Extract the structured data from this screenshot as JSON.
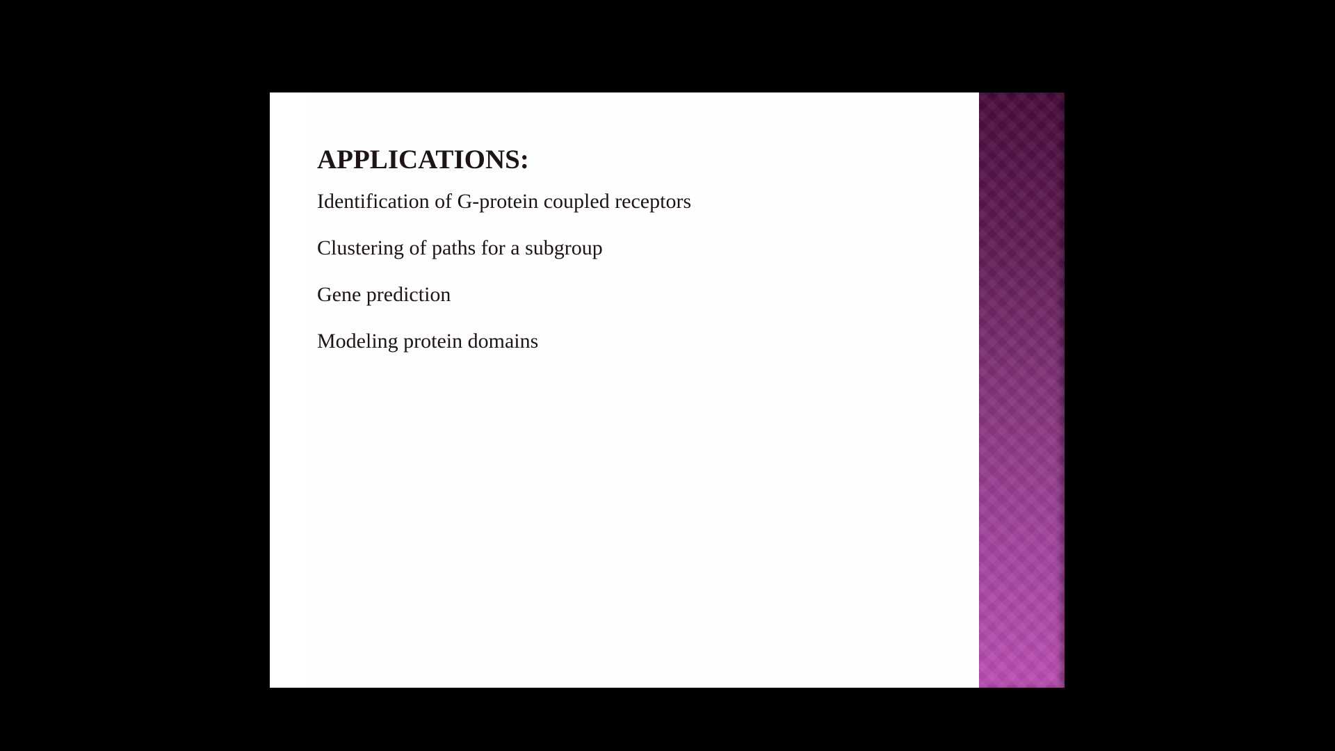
{
  "slide": {
    "title": "APPLICATIONS:",
    "items": [
      "Identification of G-protein coupled receptors",
      "Clustering of paths for a subgroup",
      "Gene prediction",
      "Modeling protein domains"
    ]
  },
  "colors": {
    "background": "#000000",
    "slide": "#ffffff",
    "text": "#1e1416",
    "accent_top": "#4a0b3c",
    "accent_bottom": "#b94fb1"
  }
}
